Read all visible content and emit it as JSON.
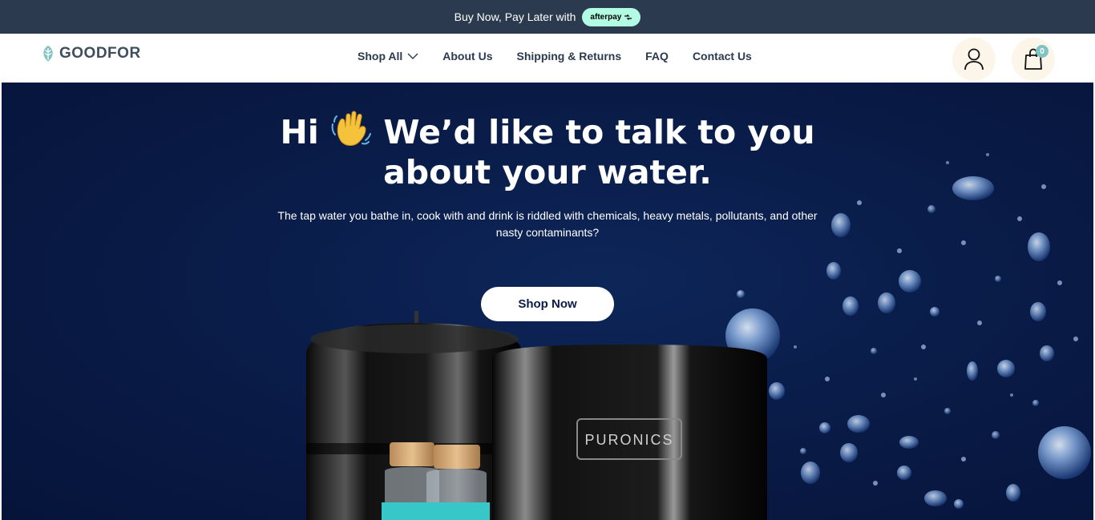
{
  "announcement": {
    "text": "Buy Now, Pay Later with",
    "badge_label": "afterpay"
  },
  "header": {
    "logo_text": "GOODFOR",
    "nav": [
      {
        "label": "Shop All",
        "has_dropdown": true
      },
      {
        "label": "About Us"
      },
      {
        "label": "Shipping & Returns"
      },
      {
        "label": "FAQ"
      },
      {
        "label": "Contact Us"
      }
    ],
    "cart_count": "0"
  },
  "hero": {
    "title_line1_a": "Hi",
    "title_line1_b": "We’d like to talk to you",
    "title_line2": "about your water.",
    "subtitle": "The tap water you bathe in, cook with and drink is riddled with chemicals, heavy metals, pollutants, and other nasty contaminants?",
    "cta_label": "Shop Now",
    "product_brand": "PURONICS"
  },
  "colors": {
    "announcement_bg": "#2b3a4f",
    "afterpay_mint": "#b2fce4",
    "hero_bg": "#091a45",
    "nav_text": "#2b3a4f",
    "icon_circle_bg": "#fcf6ea",
    "cart_badge": "#7fc4c0"
  },
  "icons": [
    "leaf-logo-icon",
    "chevron-down-icon",
    "user-icon",
    "shopping-bag-icon",
    "waving-hand-icon",
    "afterpay-arrows-icon"
  ]
}
